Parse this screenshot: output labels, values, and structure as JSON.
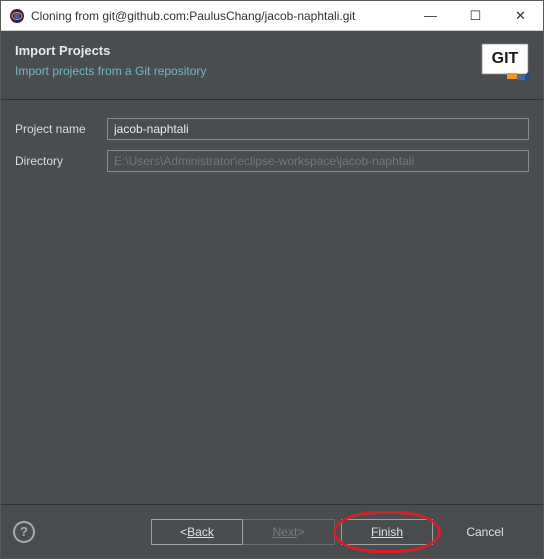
{
  "window": {
    "title": "Cloning from git@github.com:PaulusChang/jacob-naphtali.git"
  },
  "header": {
    "title": "Import Projects",
    "subtitle": "Import projects from a Git repository"
  },
  "form": {
    "project_name_label": "Project name",
    "project_name_value": "jacob-naphtali",
    "directory_label": "Directory",
    "directory_placeholder": "E:\\Users\\Administrator\\eclipse-workspace\\jacob-naphtali"
  },
  "footer": {
    "back": "Back",
    "back_prefix": "< ",
    "next": "Next",
    "next_suffix": " >",
    "finish": "Finish",
    "cancel": "Cancel",
    "help_glyph": "?"
  },
  "icons": {
    "eclipse": "◉",
    "min": "—",
    "max": "☐",
    "close": "✕"
  }
}
